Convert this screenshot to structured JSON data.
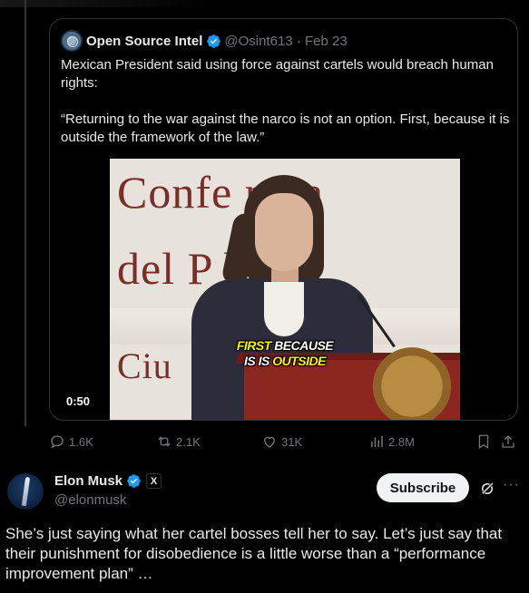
{
  "quote": {
    "name": "Open Source Intel",
    "handle": "@Osint613",
    "date": "Feb 23",
    "text_1": "Mexican President said using force against cartels would breach human rights:",
    "text_2": "“Returning to the war against the narco is not an option. First, because it is outside the framework of the law.”",
    "video": {
      "bg_word_1": "Confe  ncia",
      "bg_word_2": "del P  blo",
      "bg_word_3": "Ciu",
      "caption_line1_a": "FIRST",
      "caption_line1_b": "BECAUSE",
      "caption_line2_a": "IS IS",
      "caption_line2_b": "OUTSIDE",
      "timestamp": "0:50"
    }
  },
  "actions": {
    "replies": "1.6K",
    "retweets": "2.1K",
    "likes": "31K",
    "views": "2.8M"
  },
  "author": {
    "name": "Elon Musk",
    "handle": "@elonmusk",
    "badge": "X",
    "subscribe_label": "Subscribe",
    "more": "···"
  },
  "post": {
    "text": "She’s just saying what her cartel bosses tell her to say. Let’s just say that their punishment for disobedience is a little worse than a “performance improvement plan” …"
  },
  "colors": {
    "background": "#000000",
    "text": "#e7e9ea",
    "muted": "#71767b",
    "verified": "#1d9bf0",
    "border": "#2f3336",
    "caption_yellow": "#fff200"
  }
}
